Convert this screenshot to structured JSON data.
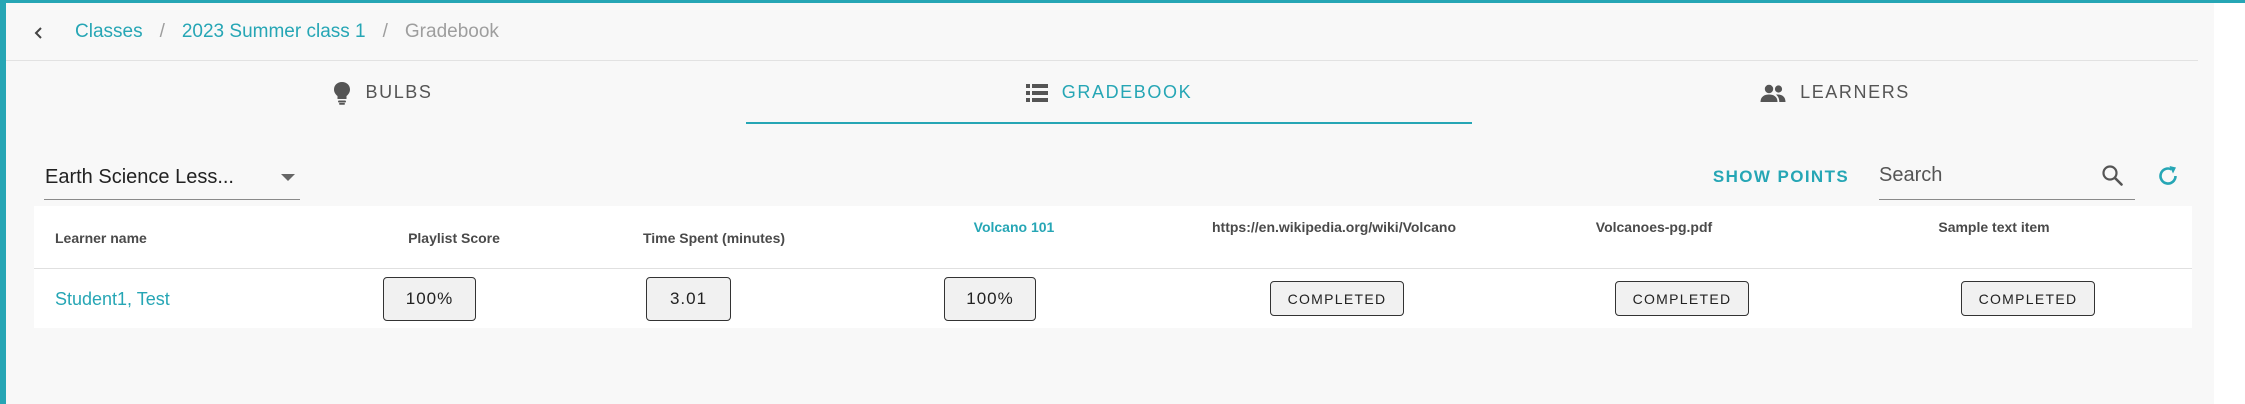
{
  "breadcrumb": {
    "back_icon": "chevron-left-icon",
    "items": [
      {
        "label": "Classes"
      },
      {
        "label": "2023 Summer class 1"
      }
    ],
    "separator": "/",
    "current": "Gradebook"
  },
  "tabs": [
    {
      "label": "BULBS",
      "icon": "lightbulb-icon",
      "active": false
    },
    {
      "label": "GRADEBOOK",
      "icon": "list-icon",
      "active": true
    },
    {
      "label": "LEARNERS",
      "icon": "people-icon",
      "active": false
    }
  ],
  "toolbar": {
    "lesson_select_value": "Earth Science Less...",
    "show_points_label": "SHOW POINTS",
    "search_placeholder": "Search",
    "search_icon": "search-icon",
    "refresh_icon": "refresh-icon"
  },
  "table": {
    "columns": [
      "Learner name",
      "Playlist Score",
      "Time Spent (minutes)",
      "Volcano 101",
      "https://en.wikipedia.org/wiki/Volcano",
      "Volcanoes-pg.pdf",
      "Sample text item"
    ],
    "rows": [
      {
        "learner": "Student1, Test",
        "playlist_score": "100%",
        "time_spent": "3.01",
        "volcano_101": "100%",
        "wikipedia": "COMPLETED",
        "pdf": "COMPLETED",
        "sample_text": "COMPLETED"
      }
    ]
  },
  "colors": {
    "accent": "#26a6b5",
    "background": "#f8f8f8",
    "text": "#333333"
  }
}
